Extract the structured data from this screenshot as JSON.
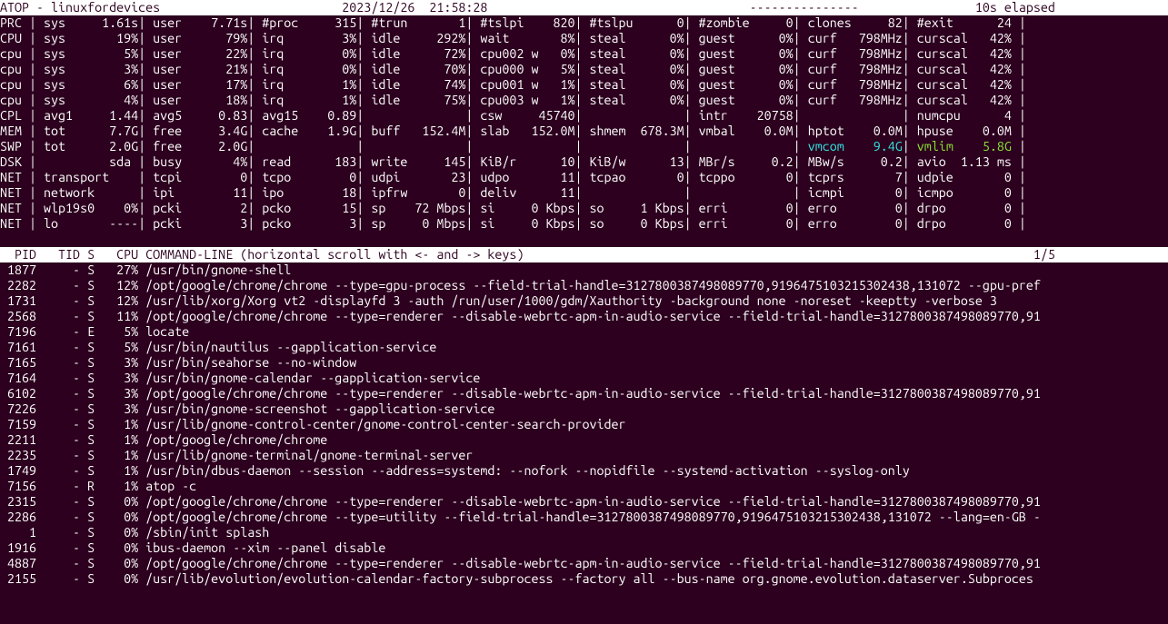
{
  "title": {
    "app": "ATOP",
    "host": "linuxfordevices",
    "date": "2023/12/26",
    "time": "21:58:28",
    "dashes": "---------------",
    "elapsed": "10s elapsed"
  },
  "sys": [
    {
      "r": "PRC",
      "c": [
        [
          "sys",
          "1.61s"
        ],
        [
          "user",
          "7.71s"
        ],
        [
          "#proc",
          "315"
        ],
        [
          "#trun",
          "1"
        ],
        [
          "#tslpi",
          "820"
        ],
        [
          "#tslpu",
          "0"
        ],
        [
          "#zombie",
          "0"
        ],
        [
          "clones",
          "82"
        ],
        [
          "#exit",
          "24"
        ]
      ]
    },
    {
      "r": "CPU",
      "c": [
        [
          "sys",
          "19%"
        ],
        [
          "user",
          "79%"
        ],
        [
          "irq",
          "3%"
        ],
        [
          "idle",
          "292%"
        ],
        [
          "wait",
          "8%"
        ],
        [
          "steal",
          "0%"
        ],
        [
          "guest",
          "0%"
        ],
        [
          "curf",
          "798MHz"
        ],
        [
          "curscal",
          "42%"
        ]
      ]
    },
    {
      "r": "cpu",
      "c": [
        [
          "sys",
          "5%"
        ],
        [
          "user",
          "22%"
        ],
        [
          "irq",
          "0%"
        ],
        [
          "idle",
          "72%"
        ],
        [
          "cpu002 w",
          "0%"
        ],
        [
          "steal",
          "0%"
        ],
        [
          "guest",
          "0%"
        ],
        [
          "curf",
          "798MHz"
        ],
        [
          "curscal",
          "42%"
        ]
      ]
    },
    {
      "r": "cpu",
      "c": [
        [
          "sys",
          "3%"
        ],
        [
          "user",
          "21%"
        ],
        [
          "irq",
          "0%"
        ],
        [
          "idle",
          "70%"
        ],
        [
          "cpu000 w",
          "5%"
        ],
        [
          "steal",
          "0%"
        ],
        [
          "guest",
          "0%"
        ],
        [
          "curf",
          "798MHz"
        ],
        [
          "curscal",
          "42%"
        ]
      ]
    },
    {
      "r": "cpu",
      "c": [
        [
          "sys",
          "6%"
        ],
        [
          "user",
          "17%"
        ],
        [
          "irq",
          "1%"
        ],
        [
          "idle",
          "74%"
        ],
        [
          "cpu001 w",
          "1%"
        ],
        [
          "steal",
          "0%"
        ],
        [
          "guest",
          "0%"
        ],
        [
          "curf",
          "798MHz"
        ],
        [
          "curscal",
          "42%"
        ]
      ]
    },
    {
      "r": "cpu",
      "c": [
        [
          "sys",
          "4%"
        ],
        [
          "user",
          "18%"
        ],
        [
          "irq",
          "1%"
        ],
        [
          "idle",
          "75%"
        ],
        [
          "cpu003 w",
          "1%"
        ],
        [
          "steal",
          "0%"
        ],
        [
          "guest",
          "0%"
        ],
        [
          "curf",
          "798MHz"
        ],
        [
          "curscal",
          "42%"
        ]
      ]
    },
    {
      "r": "CPL",
      "c": [
        [
          "avg1",
          "1.44"
        ],
        [
          "avg5",
          "0.83"
        ],
        [
          "avg15",
          "0.89"
        ],
        [
          "",
          ""
        ],
        [
          "csw",
          "45740"
        ],
        [
          "",
          ""
        ],
        [
          "intr",
          "20758"
        ],
        [
          "",
          ""
        ],
        [
          "numcpu",
          "4"
        ]
      ]
    },
    {
      "r": "MEM",
      "c": [
        [
          "tot",
          "7.7G"
        ],
        [
          "free",
          "3.4G"
        ],
        [
          "cache",
          "1.9G"
        ],
        [
          "buff",
          "152.4M"
        ],
        [
          "slab",
          "152.0M"
        ],
        [
          "shmem",
          "678.3M"
        ],
        [
          "vmbal",
          "0.0M"
        ],
        [
          "hptot",
          "0.0M"
        ],
        [
          "hpuse",
          "0.0M"
        ]
      ]
    },
    {
      "r": "SWP",
      "c": [
        [
          "tot",
          "2.0G"
        ],
        [
          "free",
          "2.0G"
        ],
        [
          "",
          ""
        ],
        [
          "",
          ""
        ],
        [
          "",
          ""
        ],
        [
          "",
          ""
        ],
        [
          "",
          ""
        ],
        [
          "vmcom",
          "9.4G",
          "cy"
        ],
        [
          "vmlim",
          "5.8G",
          "gr"
        ]
      ]
    },
    {
      "r": "DSK",
      "c": [
        [
          "",
          "sda"
        ],
        [
          "busy",
          "4%"
        ],
        [
          "read",
          "183"
        ],
        [
          "write",
          "145"
        ],
        [
          "KiB/r",
          "10"
        ],
        [
          "KiB/w",
          "13"
        ],
        [
          "MBr/s",
          "0.2"
        ],
        [
          "MBw/s",
          "0.2"
        ],
        [
          "avio",
          "1.13 ms"
        ]
      ]
    },
    {
      "r": "NET",
      "c": [
        [
          "transport",
          ""
        ],
        [
          "tcpi",
          "0"
        ],
        [
          "tcpo",
          "0"
        ],
        [
          "udpi",
          "23"
        ],
        [
          "udpo",
          "11"
        ],
        [
          "tcpao",
          "0"
        ],
        [
          "tcppo",
          "0"
        ],
        [
          "tcprs",
          "7"
        ],
        [
          "udpie",
          "0"
        ]
      ]
    },
    {
      "r": "NET",
      "c": [
        [
          "network",
          ""
        ],
        [
          "ipi",
          "11"
        ],
        [
          "ipo",
          "18"
        ],
        [
          "ipfrw",
          "0"
        ],
        [
          "deliv",
          "11"
        ],
        [
          "",
          ""
        ],
        [
          "",
          ""
        ],
        [
          "icmpi",
          "0"
        ],
        [
          "icmpo",
          "0"
        ]
      ]
    },
    {
      "r": "NET",
      "c": [
        [
          "wlp19s0",
          "0%"
        ],
        [
          "pcki",
          "2"
        ],
        [
          "pcko",
          "15"
        ],
        [
          "sp",
          "72 Mbps"
        ],
        [
          "si",
          "0 Kbps"
        ],
        [
          "so",
          "1 Kbps"
        ],
        [
          "erri",
          "0"
        ],
        [
          "erro",
          "0"
        ],
        [
          "drpo",
          "0"
        ]
      ]
    },
    {
      "r": "NET",
      "c": [
        [
          "lo",
          "----"
        ],
        [
          "pcki",
          "3"
        ],
        [
          "pcko",
          "3"
        ],
        [
          "sp",
          "0 Mbps"
        ],
        [
          "si",
          "0 Kbps"
        ],
        [
          "so",
          "0 Kbps"
        ],
        [
          "erri",
          "0"
        ],
        [
          "erro",
          "0"
        ],
        [
          "drpo",
          "0"
        ]
      ]
    }
  ],
  "proc_header": {
    "cols": "  PID   TID S   CPU COMMAND-LINE (horizontal scroll with <- and -> keys)",
    "page": "1/5"
  },
  "procs": [
    {
      "pid": "1877",
      "tid": "-",
      "s": "S",
      "cpu": "27%",
      "cmd": "/usr/bin/gnome-shell"
    },
    {
      "pid": "2282",
      "tid": "-",
      "s": "S",
      "cpu": "12%",
      "cmd": "/opt/google/chrome/chrome --type=gpu-process --field-trial-handle=3127800387498089770,9196475103215302438,131072 --gpu-pref"
    },
    {
      "pid": "1731",
      "tid": "-",
      "s": "S",
      "cpu": "12%",
      "cmd": "/usr/lib/xorg/Xorg vt2 -displayfd 3 -auth /run/user/1000/gdm/Xauthority -background none -noreset -keeptty -verbose 3"
    },
    {
      "pid": "2568",
      "tid": "-",
      "s": "S",
      "cpu": "11%",
      "cmd": "/opt/google/chrome/chrome --type=renderer --disable-webrtc-apm-in-audio-service --field-trial-handle=3127800387498089770,91"
    },
    {
      "pid": "7196",
      "tid": "-",
      "s": "E",
      "cpu": "5%",
      "cmd": "locate"
    },
    {
      "pid": "7161",
      "tid": "-",
      "s": "S",
      "cpu": "5%",
      "cmd": "/usr/bin/nautilus --gapplication-service"
    },
    {
      "pid": "7165",
      "tid": "-",
      "s": "S",
      "cpu": "3%",
      "cmd": "/usr/bin/seahorse --no-window"
    },
    {
      "pid": "7164",
      "tid": "-",
      "s": "S",
      "cpu": "3%",
      "cmd": "/usr/bin/gnome-calendar --gapplication-service"
    },
    {
      "pid": "6102",
      "tid": "-",
      "s": "S",
      "cpu": "3%",
      "cmd": "/opt/google/chrome/chrome --type=renderer --disable-webrtc-apm-in-audio-service --field-trial-handle=3127800387498089770,91"
    },
    {
      "pid": "7226",
      "tid": "-",
      "s": "S",
      "cpu": "3%",
      "cmd": "/usr/bin/gnome-screenshot --gapplication-service"
    },
    {
      "pid": "7159",
      "tid": "-",
      "s": "S",
      "cpu": "1%",
      "cmd": "/usr/lib/gnome-control-center/gnome-control-center-search-provider"
    },
    {
      "pid": "2211",
      "tid": "-",
      "s": "S",
      "cpu": "1%",
      "cmd": "/opt/google/chrome/chrome"
    },
    {
      "pid": "2235",
      "tid": "-",
      "s": "S",
      "cpu": "1%",
      "cmd": "/usr/lib/gnome-terminal/gnome-terminal-server"
    },
    {
      "pid": "1749",
      "tid": "-",
      "s": "S",
      "cpu": "1%",
      "cmd": "/usr/bin/dbus-daemon --session --address=systemd: --nofork --nopidfile --systemd-activation --syslog-only"
    },
    {
      "pid": "7156",
      "tid": "-",
      "s": "R",
      "cpu": "1%",
      "cmd": "atop -c"
    },
    {
      "pid": "2315",
      "tid": "-",
      "s": "S",
      "cpu": "0%",
      "cmd": "/opt/google/chrome/chrome --type=renderer --disable-webrtc-apm-in-audio-service --field-trial-handle=3127800387498089770,91"
    },
    {
      "pid": "2286",
      "tid": "-",
      "s": "S",
      "cpu": "0%",
      "cmd": "/opt/google/chrome/chrome --type=utility --field-trial-handle=3127800387498089770,9196475103215302438,131072 --lang=en-GB -"
    },
    {
      "pid": "1",
      "tid": "-",
      "s": "S",
      "cpu": "0%",
      "cmd": "/sbin/init splash"
    },
    {
      "pid": "1916",
      "tid": "-",
      "s": "S",
      "cpu": "0%",
      "cmd": "ibus-daemon --xim --panel disable"
    },
    {
      "pid": "4887",
      "tid": "-",
      "s": "S",
      "cpu": "0%",
      "cmd": "/opt/google/chrome/chrome --type=renderer --disable-webrtc-apm-in-audio-service --field-trial-handle=3127800387498089770,91"
    },
    {
      "pid": "2155",
      "tid": "-",
      "s": "S",
      "cpu": "0%",
      "cmd": "/usr/lib/evolution/evolution-calendar-factory-subprocess --factory all --bus-name org.gnome.evolution.dataserver.Subproces"
    }
  ]
}
